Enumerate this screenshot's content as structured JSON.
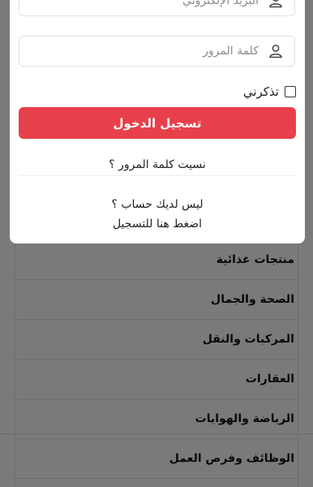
{
  "login": {
    "email_placeholder": "البريد الإلكتروني",
    "password_placeholder": "كلمة المرور",
    "remember_label": "تذكرني",
    "submit_label": "تسجيل الدخول",
    "forgot_link": "نسيت كلمة المرور ؟",
    "no_account_text": "ليس لديك حساب ؟",
    "register_link": "اضغط هنا للتسجيل"
  },
  "categories": [
    {
      "label": "منتجات غذائية"
    },
    {
      "label": "الصحة والجمال"
    },
    {
      "label": "المركبات والنقل"
    },
    {
      "label": "العقارات"
    },
    {
      "label": "الرياضة والهوايات"
    },
    {
      "label": "الوظائف وفرص العمل"
    }
  ],
  "colors": {
    "accent": "#e8404b",
    "overlay": "rgba(0,0,0,0.5)"
  }
}
